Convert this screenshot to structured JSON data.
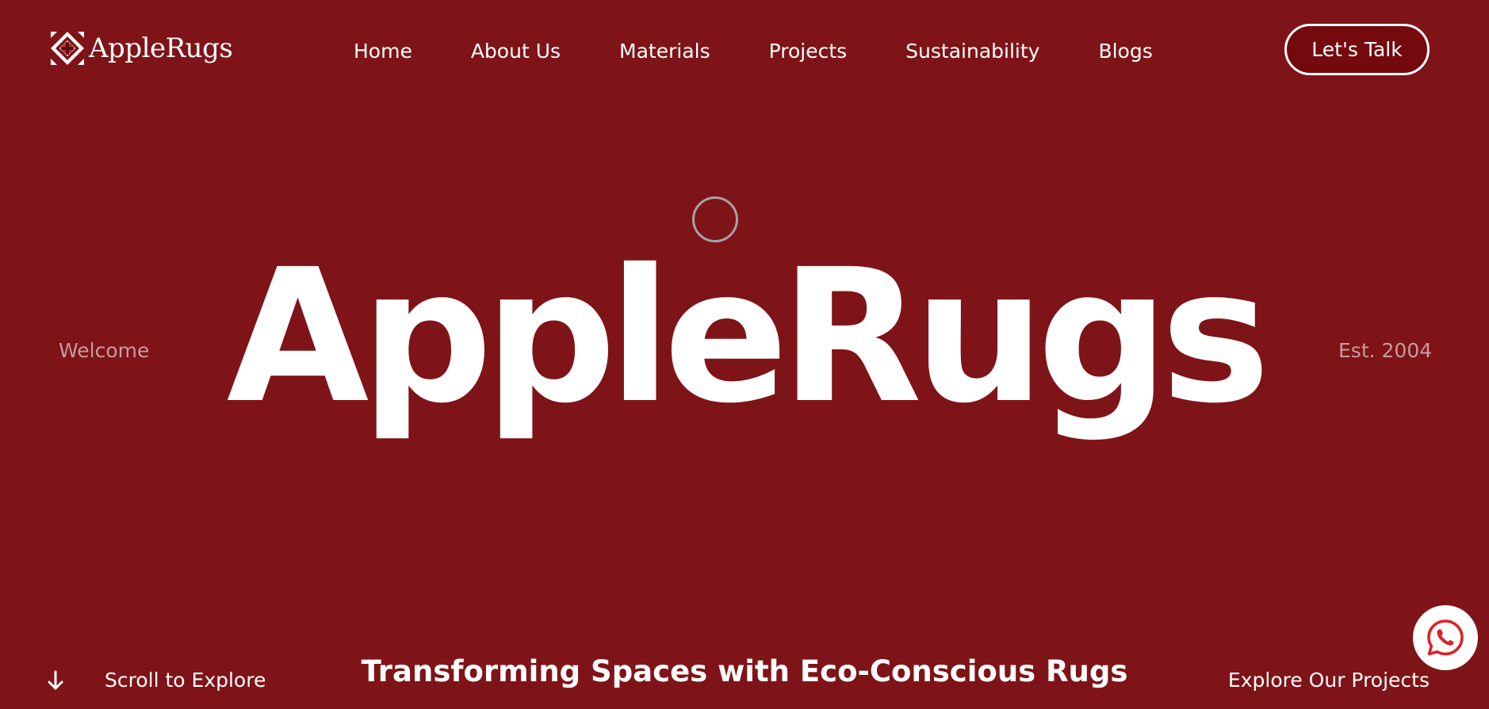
{
  "brand": {
    "name": "AppleRugs"
  },
  "nav": {
    "items": [
      "Home",
      "About Us",
      "Materials",
      "Projects",
      "Sustainability",
      "Blogs"
    ]
  },
  "header": {
    "cta_label": "Let's Talk"
  },
  "hero": {
    "left_label": "Welcome",
    "title": "AppleRugs",
    "right_label": "Est. 2004"
  },
  "footer_row": {
    "scroll_label": "Scroll to Explore",
    "tagline": "Transforming Spaces with Eco-Conscious Rugs",
    "explore_label": "Explore Our Projects"
  },
  "icons": {
    "logo": "applerugs-logo-icon",
    "scroll": "arrow-down-icon",
    "whatsapp": "whatsapp-icon",
    "cursor": "cursor-ring-icon"
  },
  "colors": {
    "background": "#7f1418",
    "cta_background": "#74090e",
    "muted_text": "#c79b9d",
    "whatsapp_red": "#d8232a",
    "text": "#ffffff"
  }
}
